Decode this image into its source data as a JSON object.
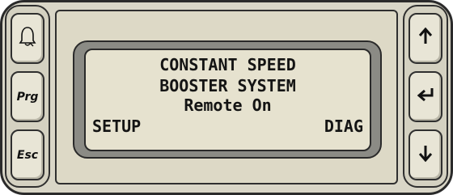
{
  "left_keys": [
    {
      "name": "alarm",
      "icon": "bell-icon",
      "label": ""
    },
    {
      "name": "program",
      "icon": "",
      "label": "Prg"
    },
    {
      "name": "escape",
      "icon": "",
      "label": "Esc"
    }
  ],
  "right_keys": [
    {
      "name": "up",
      "icon": "arrow-up-icon"
    },
    {
      "name": "enter",
      "icon": "enter-icon"
    },
    {
      "name": "down",
      "icon": "arrow-down-icon"
    }
  ],
  "display": {
    "line1": "CONSTANT SPEED",
    "line2": "BOOSTER SYSTEM",
    "line3": "Remote On",
    "softkey_left": "SETUP",
    "softkey_right": "DIAG"
  },
  "colors": {
    "panel": "#d9d6c7",
    "lcd_background": "#e6e2cf",
    "bezel": "#8b8b85",
    "text": "#141414"
  }
}
